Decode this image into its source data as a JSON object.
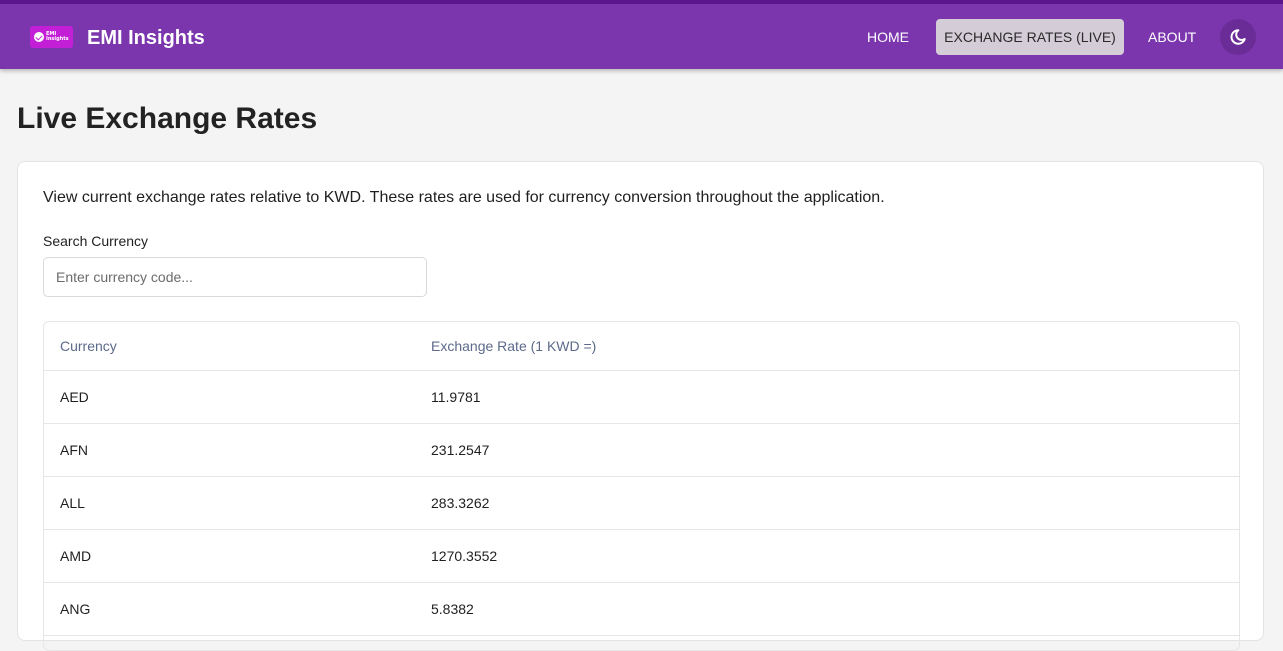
{
  "header": {
    "logo_text": "EMI\nInsights",
    "brand": "EMI Insights",
    "nav": {
      "home": "HOME",
      "exchange_rates": "EXCHANGE RATES (LIVE)",
      "about": "ABOUT"
    },
    "theme_icon": "moon-icon"
  },
  "page": {
    "title": "Live Exchange Rates",
    "intro": "View current exchange rates relative to KWD. These rates are used for currency conversion throughout the application.",
    "search": {
      "label": "Search Currency",
      "placeholder": "Enter currency code...",
      "value": ""
    }
  },
  "table": {
    "columns": [
      "Currency",
      "Exchange Rate (1 KWD =)"
    ],
    "rows": [
      [
        "AED",
        "11.9781"
      ],
      [
        "AFN",
        "231.2547"
      ],
      [
        "ALL",
        "283.3262"
      ],
      [
        "AMD",
        "1270.3552"
      ],
      [
        "ANG",
        "5.8382"
      ]
    ]
  },
  "colors": {
    "header_bg": "#7b35ad",
    "header_border": "#5a168f",
    "active_nav_bg": "#d4ccd7",
    "logo_bg": "#c21fd6",
    "page_bg": "#f4f4f4"
  }
}
